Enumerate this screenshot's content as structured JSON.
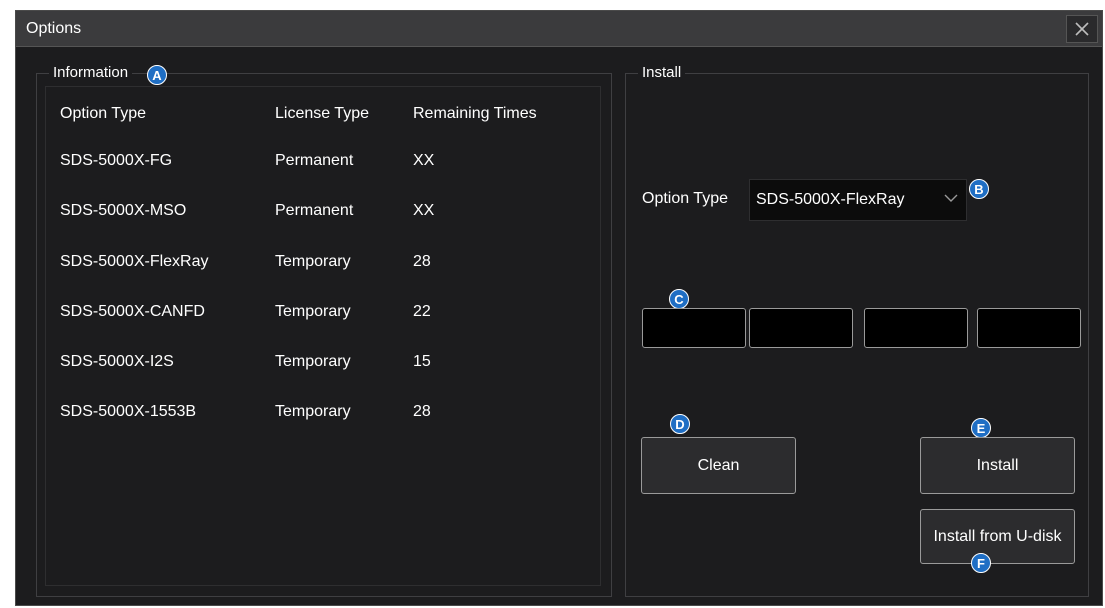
{
  "window": {
    "title": "Options",
    "close_icon": "close-icon"
  },
  "information": {
    "title": "Information",
    "marker": "A",
    "columns": [
      "Option Type",
      "License Type",
      "Remaining Times"
    ],
    "rows": [
      [
        "SDS-5000X-FG",
        "Permanent",
        "XX"
      ],
      [
        "SDS-5000X-MSO",
        "Permanent",
        "XX"
      ],
      [
        "SDS-5000X-FlexRay",
        "Temporary",
        "28"
      ],
      [
        "SDS-5000X-CANFD",
        "Temporary",
        "22"
      ],
      [
        "SDS-5000X-I2S",
        "Temporary",
        "15"
      ],
      [
        "SDS-5000X-1553B",
        "Temporary",
        "28"
      ]
    ]
  },
  "install": {
    "title": "Install",
    "option_type_label": "Option Type",
    "option_type_value": "SDS-5000X-FlexRay",
    "markers": {
      "b": "B",
      "c": "C",
      "d": "D",
      "e": "E",
      "f": "F"
    },
    "license_code_fields": [
      "",
      "",
      "",
      ""
    ],
    "clean_label": "Clean",
    "install_label": "Install",
    "install_udisk_label": "Install from U-disk"
  },
  "colors": {
    "background": "#1c1c1e",
    "titlebar": "#3b3b3d",
    "marker": "#1f6ec4",
    "text": "#ffffff"
  }
}
